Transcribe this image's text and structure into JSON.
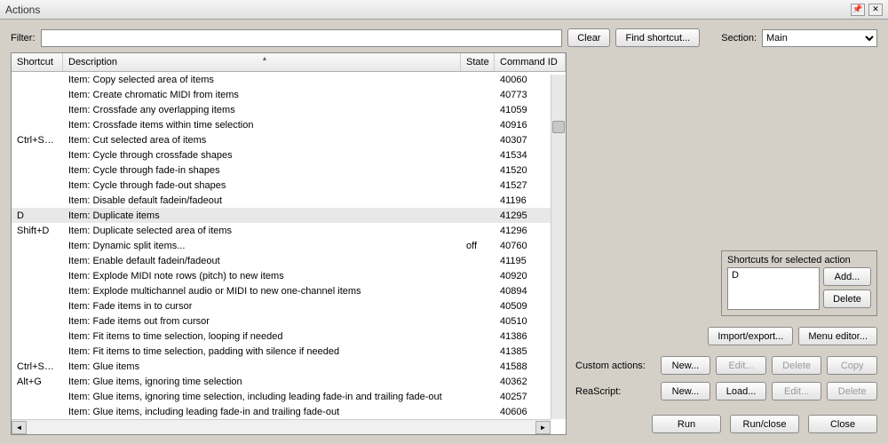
{
  "window": {
    "title": "Actions"
  },
  "topbar": {
    "filter_label": "Filter:",
    "clear": "Clear",
    "find_shortcut": "Find shortcut...",
    "section_label": "Section:",
    "section_value": "Main"
  },
  "columns": {
    "shortcut": "Shortcut",
    "description": "Description",
    "state": "State",
    "command_id": "Command ID"
  },
  "rows": [
    {
      "shortcut": "",
      "desc": "Item: Copy selected area of items",
      "state": "",
      "cmd": "40060"
    },
    {
      "shortcut": "",
      "desc": "Item: Create chromatic MIDI from items",
      "state": "",
      "cmd": "40773"
    },
    {
      "shortcut": "",
      "desc": "Item: Crossfade any overlapping items",
      "state": "",
      "cmd": "41059"
    },
    {
      "shortcut": "",
      "desc": "Item: Crossfade items within time selection",
      "state": "",
      "cmd": "40916"
    },
    {
      "shortcut": "Ctrl+SU...",
      "desc": "Item: Cut selected area of items",
      "state": "",
      "cmd": "40307"
    },
    {
      "shortcut": "",
      "desc": "Item: Cycle through crossfade shapes",
      "state": "",
      "cmd": "41534"
    },
    {
      "shortcut": "",
      "desc": "Item: Cycle through fade-in shapes",
      "state": "",
      "cmd": "41520"
    },
    {
      "shortcut": "",
      "desc": "Item: Cycle through fade-out shapes",
      "state": "",
      "cmd": "41527"
    },
    {
      "shortcut": "",
      "desc": "Item: Disable default fadein/fadeout",
      "state": "",
      "cmd": "41196"
    },
    {
      "shortcut": "D",
      "desc": "Item: Duplicate items",
      "state": "",
      "cmd": "41295",
      "selected": true
    },
    {
      "shortcut": "Shift+D",
      "desc": "Item: Duplicate selected area of items",
      "state": "",
      "cmd": "41296"
    },
    {
      "shortcut": "",
      "desc": "Item: Dynamic split items...",
      "state": "off",
      "cmd": "40760"
    },
    {
      "shortcut": "",
      "desc": "Item: Enable default fadein/fadeout",
      "state": "",
      "cmd": "41195"
    },
    {
      "shortcut": "",
      "desc": "Item: Explode MIDI note rows (pitch) to new items",
      "state": "",
      "cmd": "40920"
    },
    {
      "shortcut": "",
      "desc": "Item: Explode multichannel audio or MIDI to new one-channel items",
      "state": "",
      "cmd": "40894"
    },
    {
      "shortcut": "",
      "desc": "Item: Fade items in to cursor",
      "state": "",
      "cmd": "40509"
    },
    {
      "shortcut": "",
      "desc": "Item: Fade items out from cursor",
      "state": "",
      "cmd": "40510"
    },
    {
      "shortcut": "",
      "desc": "Item: Fit items to time selection, looping if needed",
      "state": "",
      "cmd": "41386"
    },
    {
      "shortcut": "",
      "desc": "Item: Fit items to time selection, padding with silence if needed",
      "state": "",
      "cmd": "41385"
    },
    {
      "shortcut": "Ctrl+Shif...",
      "desc": "Item: Glue items",
      "state": "",
      "cmd": "41588"
    },
    {
      "shortcut": "Alt+G",
      "desc": "Item: Glue items, ignoring time selection",
      "state": "",
      "cmd": "40362"
    },
    {
      "shortcut": "",
      "desc": "Item: Glue items, ignoring time selection, including leading fade-in and trailing fade-out",
      "state": "",
      "cmd": "40257"
    },
    {
      "shortcut": "",
      "desc": "Item: Glue items, including leading fade-in and trailing fade-out",
      "state": "",
      "cmd": "40606"
    }
  ],
  "shortcuts_panel": {
    "title": "Shortcuts for selected action",
    "current": "D",
    "add": "Add...",
    "delete": "Delete"
  },
  "side_buttons": {
    "import_export": "Import/export...",
    "menu_editor": "Menu editor..."
  },
  "custom_actions": {
    "label": "Custom actions:",
    "new": "New...",
    "edit": "Edit...",
    "delete": "Delete",
    "copy": "Copy"
  },
  "reascript": {
    "label": "ReaScript:",
    "new": "New...",
    "load": "Load...",
    "edit": "Edit...",
    "delete": "Delete"
  },
  "bottom": {
    "run": "Run",
    "run_close": "Run/close",
    "close": "Close"
  }
}
